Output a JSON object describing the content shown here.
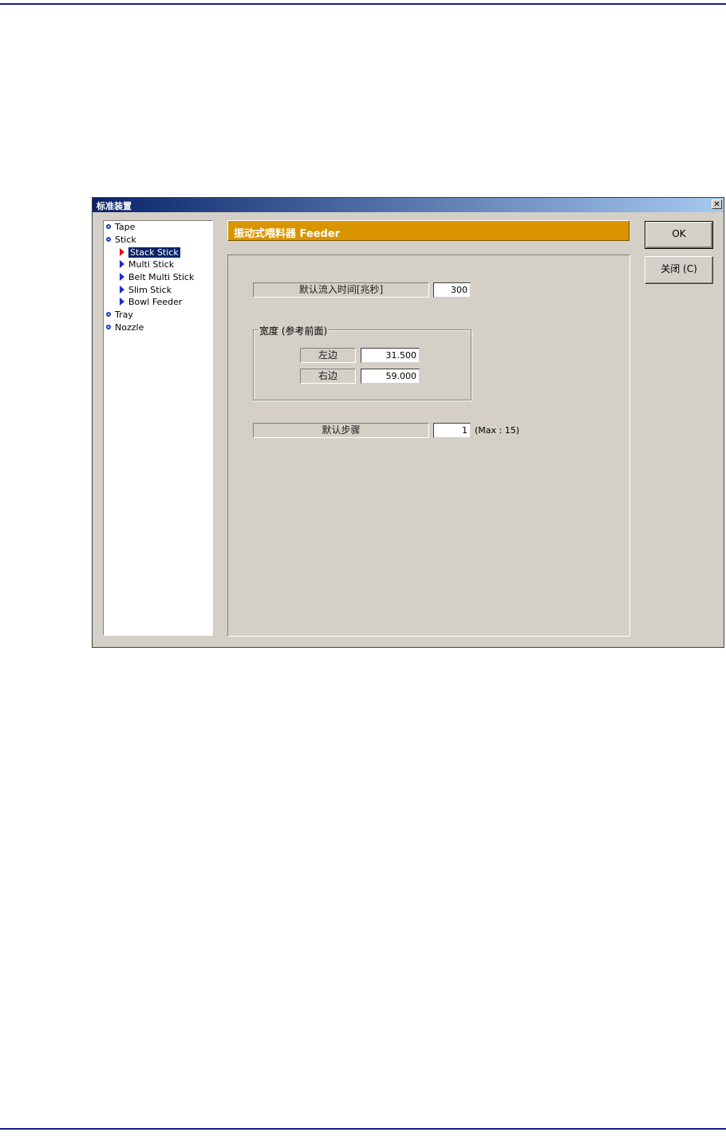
{
  "dialog": {
    "title": "标准装置",
    "close_glyph": "✕"
  },
  "tree": {
    "items": [
      {
        "label": "Tape",
        "level": 0,
        "icon": "bullet-icon"
      },
      {
        "label": "Stick",
        "level": 0,
        "icon": "bullet-icon"
      },
      {
        "label": "Stack Stick",
        "level": 1,
        "icon": "triangle-icon",
        "selected": true
      },
      {
        "label": "Multi Stick",
        "level": 1,
        "icon": "triangle-icon"
      },
      {
        "label": "Belt Multi Stick",
        "level": 1,
        "icon": "triangle-icon"
      },
      {
        "label": "Slim Stick",
        "level": 1,
        "icon": "triangle-icon"
      },
      {
        "label": "Bowl Feeder",
        "level": 1,
        "icon": "triangle-icon"
      },
      {
        "label": "Tray",
        "level": 0,
        "icon": "bullet-icon"
      },
      {
        "label": "Nozzle",
        "level": 0,
        "icon": "bullet-icon"
      }
    ]
  },
  "header": {
    "title": "振动式喂料器 Feeder",
    "color": "#d99400"
  },
  "form": {
    "inflow_label": "默认流入时间[兆秒]",
    "inflow_value": "300",
    "width_group_label": "宽度 (参考前面)",
    "left_label": "左边",
    "left_value": "31.500",
    "right_label": "右边",
    "right_value": "59.000",
    "step_label": "默认步骤",
    "step_value": "1",
    "step_hint": "(Max : 15)"
  },
  "buttons": {
    "ok_label": "OK",
    "close_label": "关闭 (C)"
  },
  "colors": {
    "title_bar_start": "#0a246a",
    "title_bar_end": "#a6caf0",
    "selection": "#0a246a",
    "page_rule": "#1b1f8c"
  }
}
